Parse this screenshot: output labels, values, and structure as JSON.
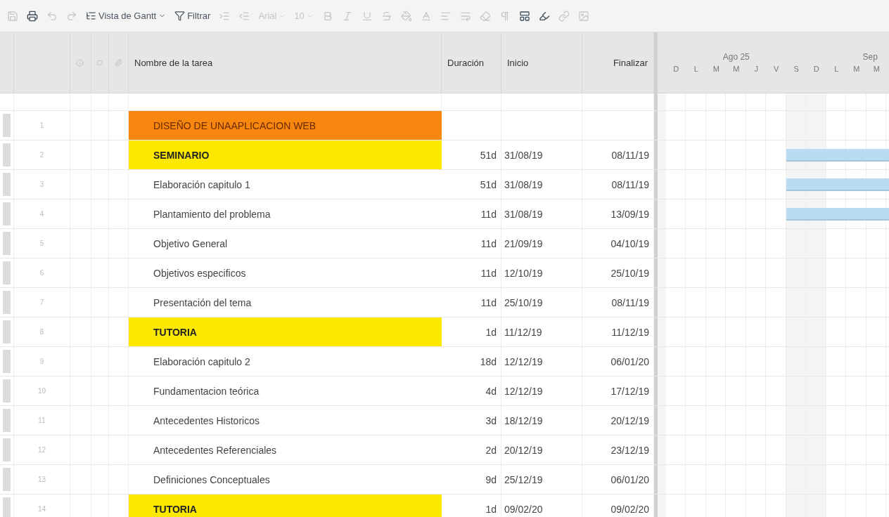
{
  "toolbar": {
    "items": [
      {
        "kind": "icon",
        "disabled": true
      },
      {
        "kind": "icon",
        "disabled": false
      },
      {
        "kind": "icon",
        "disabled": true
      },
      {
        "kind": "icon",
        "disabled": true
      },
      {
        "kind": "menu",
        "label": "Vista de Gantt",
        "disabled": false
      },
      {
        "kind": "menu",
        "label": "Filtrar",
        "disabled": false
      },
      {
        "kind": "icon",
        "disabled": true
      },
      {
        "kind": "icon",
        "disabled": true
      },
      {
        "kind": "dropdown",
        "label": "Arial",
        "disabled": true
      },
      {
        "kind": "dropdown",
        "label": "10",
        "disabled": true
      },
      {
        "kind": "icon",
        "disabled": true
      },
      {
        "kind": "icon",
        "disabled": true
      },
      {
        "kind": "icon",
        "disabled": true
      },
      {
        "kind": "icon",
        "disabled": true
      },
      {
        "kind": "icon",
        "disabled": true
      },
      {
        "kind": "icon",
        "disabled": true
      },
      {
        "kind": "icon",
        "disabled": true
      },
      {
        "kind": "icon",
        "disabled": true
      },
      {
        "kind": "icon",
        "disabled": true
      },
      {
        "kind": "icon",
        "disabled": true
      },
      {
        "kind": "icon",
        "disabled": false
      },
      {
        "kind": "icon",
        "disabled": false
      },
      {
        "kind": "icon",
        "disabled": true
      },
      {
        "kind": "icon",
        "disabled": true
      }
    ]
  },
  "table": {
    "columns": [
      "Nombre de la tarea",
      "Duración",
      "Inicio",
      "Finalizar"
    ],
    "rows": [
      {
        "number": "1",
        "kind": "project",
        "name": "DISEÑO DE UNAAPLICACION WEB",
        "bar": false
      },
      {
        "number": "2",
        "kind": "summary",
        "name": "SEMINARIO",
        "duration": "51d",
        "start": "31/08/19",
        "end": "08/11/19",
        "bar": true
      },
      {
        "number": "3",
        "kind": "task",
        "name": "Elaboración capitulo 1",
        "duration": "51d",
        "start": "31/08/19",
        "end": "08/11/19",
        "bar": true
      },
      {
        "number": "4",
        "kind": "task",
        "name": "Plantamiento del problema",
        "duration": "11d",
        "start": "31/08/19",
        "end": "13/09/19",
        "bar": true
      },
      {
        "number": "5",
        "kind": "task",
        "name": "Objetivo General",
        "duration": "11d",
        "start": "21/09/19",
        "end": "04/10/19",
        "bar": false
      },
      {
        "number": "6",
        "kind": "task",
        "name": "Objetivos especificos",
        "duration": "11d",
        "start": "12/10/19",
        "end": "25/10/19",
        "bar": false
      },
      {
        "number": "7",
        "kind": "task",
        "name": "Presentación del tema",
        "duration": "11d",
        "start": "25/10/19",
        "end": "08/11/19",
        "bar": false
      },
      {
        "number": "8",
        "kind": "summary",
        "name": "TUTORIA",
        "duration": "1d",
        "start": "11/12/19",
        "end": "11/12/19",
        "bar": false
      },
      {
        "number": "9",
        "kind": "task",
        "name": "Elaboración capitulo 2",
        "duration": "18d",
        "start": "12/12/19",
        "end": "06/01/20",
        "bar": false
      },
      {
        "number": "10",
        "kind": "task",
        "name": "Fundamentacion teórica",
        "duration": "4d",
        "start": "12/12/19",
        "end": "17/12/19",
        "bar": false
      },
      {
        "number": "11",
        "kind": "task",
        "name": "Antecedentes Historicos",
        "duration": "3d",
        "start": "18/12/19",
        "end": "20/12/19",
        "bar": false
      },
      {
        "number": "12",
        "kind": "task",
        "name": "Antecedentes Referenciales",
        "duration": "2d",
        "start": "20/12/19",
        "end": "23/12/19",
        "bar": false
      },
      {
        "number": "13",
        "kind": "task",
        "name": "Definiciones Conceptuales",
        "duration": "9d",
        "start": "25/12/19",
        "end": "06/01/20",
        "bar": false
      },
      {
        "number": "14",
        "kind": "summary",
        "name": "TUTORIA",
        "duration": "1d",
        "start": "09/02/20",
        "end": "09/02/20",
        "bar": false
      }
    ]
  },
  "gantt": {
    "weeks": [
      "Ago 25",
      "Sep"
    ],
    "days": [
      "D",
      "L",
      "M",
      "M",
      "J",
      "V",
      "S",
      "D",
      "L",
      "M",
      "M"
    ]
  }
}
